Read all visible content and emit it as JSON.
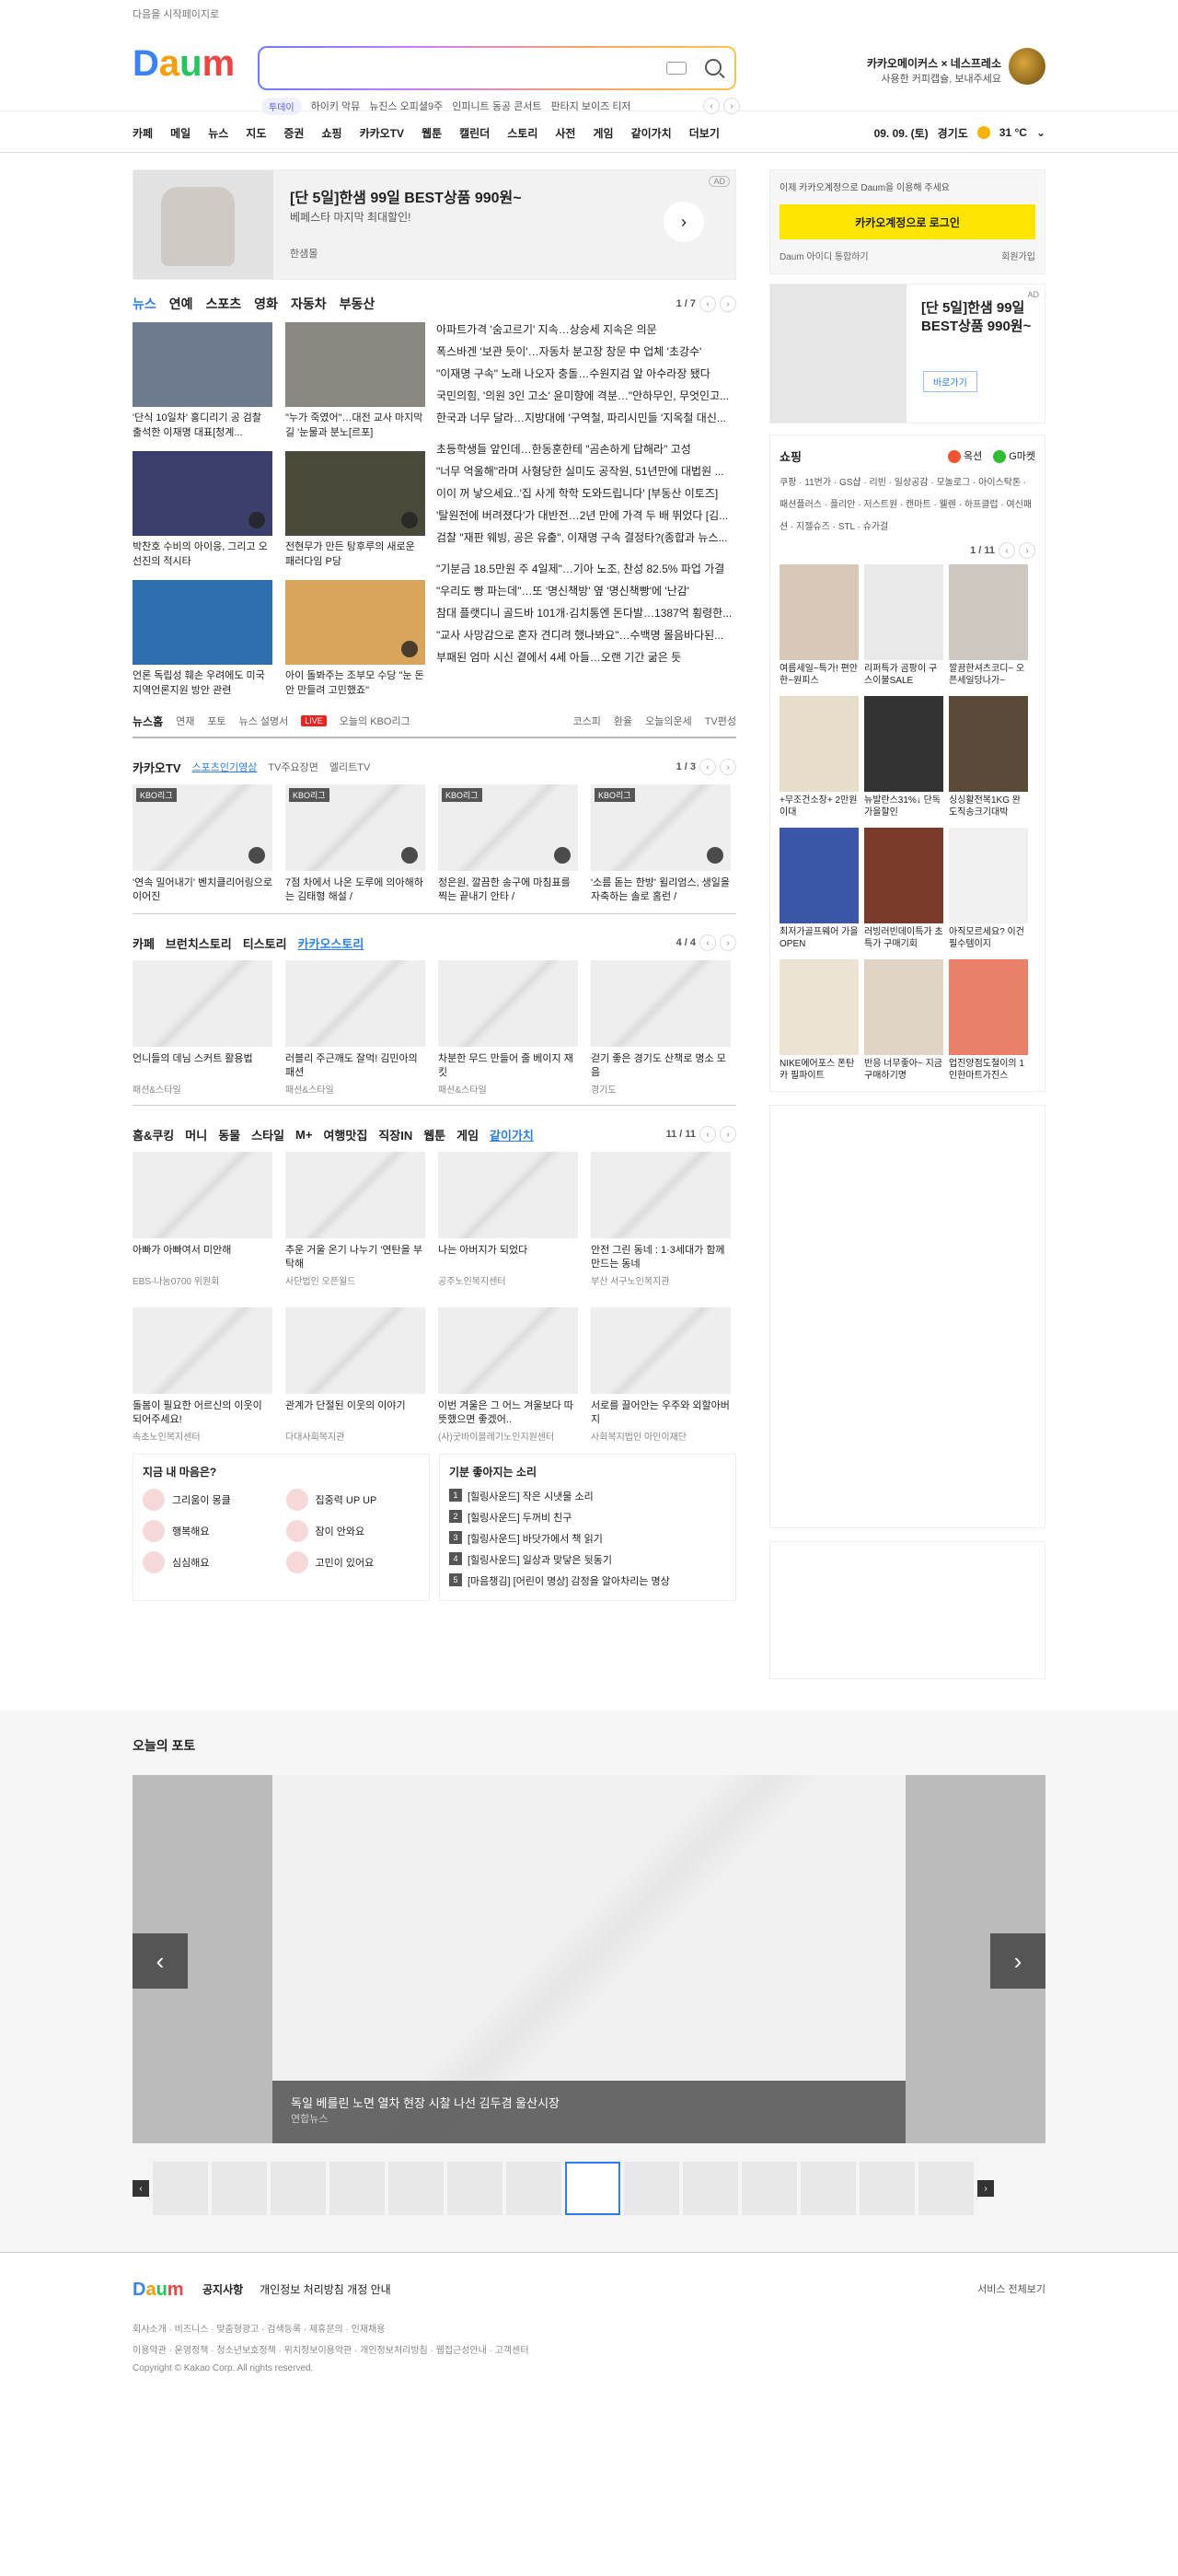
{
  "top_link": "다음을 시작페이지로",
  "search": {
    "placeholder": ""
  },
  "trend": {
    "tag": "투데이",
    "items": [
      "하이키 악뮤",
      "뉴진스 오피셜9주",
      "인피니트 동공 콘서트",
      "판타지 보이즈 티저"
    ]
  },
  "promo": {
    "title": "카카오메이커스 × 네스프레소",
    "sub": "사용한 커피캡슐, 보내주세요"
  },
  "gnb": [
    "카페",
    "메일",
    "뉴스",
    "지도",
    "증권",
    "쇼핑",
    "카카오TV",
    "웹툰",
    "캘린더",
    "스토리",
    "사전",
    "게임",
    "같이가치",
    "더보기"
  ],
  "weather": {
    "date": "09. 09. (토)",
    "region": "경기도",
    "temp": "31 °C"
  },
  "ad_main": {
    "title": "[단 5일]한샘 99일 BEST상품 990원~",
    "sub": "베페스타 마지막 최대할인!",
    "brand": "한샘몰",
    "tag": "AD"
  },
  "news_tabs": [
    "뉴스",
    "연예",
    "스포츠",
    "영화",
    "자동차",
    "부동산"
  ],
  "news_pager": "1 / 7",
  "news_thumbs": [
    {
      "cap": "'단식 10일차' 홍디리기 공 검찰 출석한 이재명 대표[청계..."
    },
    {
      "cap": "\"누가 죽였어\"…대전 교사 마지막길 '눈물과 분노[르포]"
    },
    {
      "cap": "박찬호 수비의 아이응, 그리고 오선진의 적시타"
    },
    {
      "cap": "전현무가 만든 탕후루의 새로운 패러다임 P당"
    },
    {
      "cap": "언론 독립성 훼손 우려에도 미국 지역언론지원 방안 관련"
    },
    {
      "cap": "아이 돌봐주는 조부모 수당 \"눈 돈 안 만들려 고민했죠\""
    }
  ],
  "headlines": [
    [
      "아파트가격 '숨고르기' 지속…상승세 지속은 의문",
      "폭스바겐 '보관 듯이'…자동차 분고장 창문 中 업체 '초강수'",
      "\"이재명 구속\" 노래 나오자 충돌…수원지검 앞 아수라장 됐다",
      "국민의힘, '의원 3인 고소' 윤미향에 격분…\"안하무인, 무엇인고...",
      "한국과 너무 달라…지방대에 '구역철, 파리시민들 '지옥철 대신..."
    ],
    [
      "초등학생들 앞인데…한동훈한테 \"곰손하게 답해라\" 고성",
      "\"너무 억울해\"라며 사형당한 실미도 공작원, 51년만에 대법원 ...",
      "이이 꺼 낳으세요..'집 사게 학학 도와드립니다' [부동산 이토즈]",
      "'탈원전에 버려졌다'가 대반전…2년 만에 가격 두 배 뛰었다 [김...",
      "검찰 \"재판 웨빙, 공은 유출\", 이재명 구속 결정타?(종합과 뉴스..."
    ],
    [
      "\"기분금 18.5만원 주 4일제\"…기아 노조, 찬성 82.5% 파업 가결",
      "\"우리도 빵 파는데\"…또 '명신책방' 옆 '명신책빵'에 '난감'",
      "참대 플랫디니 골드바 101개·김치통엔 돈다발…1387억 횡령한...",
      "\"교사 사망감으로 혼자 견디려 했나봐요\"…수백명 몰음바다된...",
      "부패된 엄마 시신 곁에서 4세 아들…오랜 기간 굶은 듯"
    ]
  ],
  "newsbar": {
    "title": "뉴스홈",
    "links": [
      "연재",
      "포토",
      "뉴스 설명서"
    ],
    "live": "LIVE",
    "live_text": "오늘의 KBO리그",
    "right": [
      "코스피",
      "환율",
      "오늘의운세",
      "TV편성"
    ]
  },
  "kakaotv": {
    "title": "카카오TV",
    "tab_on": "스포츠인기영상",
    "tabs": [
      "TV주요장면",
      "엘리트TV"
    ],
    "pager": "1 / 3",
    "badge": "KBO리그",
    "items": [
      "'연속 밀어내기' 벤치클리어링으로 이어진",
      "7점 차에서 나온 도루에 의아해하는 김태형 해설 /",
      "정은원, 깔끔한 송구에 마침표를 찍는 끝내기 안타 /",
      "'소름 돋는 한방' 윌리엄스, 생일을 자축하는 솔로 홈런 /"
    ]
  },
  "cafe": {
    "tabs": [
      "카페",
      "브런치스토리",
      "티스토리"
    ],
    "tab_on": "카카오스토리",
    "pager": "4 / 4",
    "items": [
      {
        "t": "언니들의 데님 스커트 활용법",
        "s": "패션&스타일"
      },
      {
        "t": "러블리 주근깨도 잘먹! 김민아의 패션",
        "s": "패션&스타일"
      },
      {
        "t": "차분한 무드 만들어 줄 베이지 재킷",
        "s": "패션&스타일"
      },
      {
        "t": "걷기 좋은 경기도 산책로 명소 모음",
        "s": "경기도"
      }
    ]
  },
  "home": {
    "tabs": [
      "홈&쿠킹",
      "머니",
      "동물",
      "스타일",
      "M+",
      "여행맛집",
      "직장IN",
      "웹툰",
      "게임"
    ],
    "tab_on": "같이가치",
    "pager": "11 / 11",
    "items": [
      {
        "t": "아빠가 아빠여서 미안해",
        "s": "EBS-나눔0700 위원회"
      },
      {
        "t": "추운 거울 온기 나누기 '연탄을 부탁해",
        "s": "사단법인 오픈월드"
      },
      {
        "t": "나는 아버지가 되었다",
        "s": "공주노인복지센터"
      },
      {
        "t": "안전 그린 동네 : 1·3세대가 함께 만드는 동네",
        "s": "부산 서구노인복지관"
      },
      {
        "t": "돌봄이 필요한 어르신의 이웃이 되어주세요!",
        "s": "속초노인복지센터"
      },
      {
        "t": "관계가 단절된 이웃의 이야기",
        "s": "다대사회복지관"
      },
      {
        "t": "이번 겨울은 그 어느 겨울보다 따뜻했으면 좋겠어..",
        "s": "(사)굿바이블레기노인지원센터"
      },
      {
        "t": "서로를 끌어안는 우주와 외할아버지",
        "s": "사회복지법인 아인이재단"
      }
    ]
  },
  "mood": {
    "title": "지금 내 마음은?",
    "items": [
      "그리움이 몽클",
      "집중력 UP UP",
      "행복해요",
      "잠이 안와요",
      "심심해요",
      "고민이 있어요"
    ]
  },
  "sound": {
    "title": "기분 좋아지는 소리",
    "items": [
      "[힐링사운드] 작은 시냇물 소리",
      "[힐링사운드] 두꺼비 친구",
      "[힐링사운드] 바닷가에서 책 읽기",
      "[힐링사운드] 일상과 맞닿은 뒷동기",
      "[마음챙김] [어린이 명상] 감정을 알아차리는 명상"
    ]
  },
  "login": {
    "notice": "이제 카카오계정으로 Daum을 이용해 주세요",
    "btn": "카카오계정으로 로그인",
    "left": "Daum 아이디 통합하기",
    "right": "회원가입"
  },
  "ad_right": {
    "title": "[단 5일]한샘 99일 BEST상품 990원~",
    "btn": "바로가기",
    "tag": "AD"
  },
  "shop": {
    "title": "쇼핑",
    "malls": [
      "옥션",
      "G마켓"
    ],
    "links": "쿠팡 · 11번가 · GS샵 · 리빈 · 일상공감 · 모놀로그 · 아이스탁톤 · 패션플러스 · 플리안 · 저스트원 · 캔마트 · 웰렌 · 하프클럽 · 여신패션 · 지젤슈즈 · STL · 슈가걸",
    "pager": "1 / 11",
    "items": [
      "여름세일~특가! 편안한~원피스",
      "리퍼특가 곰팡이 구스이불SALE",
      "깔끔한셔츠코디~ 오픈세일당나가~",
      "+무조건소장+ 2만원이대",
      "뉴발란스31%↓ 단독가을할인",
      "싱싱활전복1KG 완도직송크기대박",
      "최저가골프웨어 가을 OPEN",
      "러빙러빈데이특가 초특가 구매기회",
      "아직모르세요? 이건 필수템이지",
      "NIKE에어포스 폰탄카 필파이트",
      "반응 너무좋아~ 지금 구매하기명",
      "업진양점도철이의 1인한마트가진스"
    ]
  },
  "photo": {
    "title": "오늘의 포토",
    "caption": "독일 베를린 노면 열차 현장 시찰 나선 김두겸 울산시장",
    "source": "연합뉴스"
  },
  "footer": {
    "notice_label": "공지사항",
    "notice": "개인정보 처리방침 개정 안내",
    "more": "서비스 전체보기",
    "row1": "회사소개 · 비즈니스 · 맞춤형광고 · 검색등록 · 제휴문의 · 인재채용",
    "row2": "이용약관 · 운영정책 · 청소년보호정책 · 위치정보이용약관 · 개인정보처리방침 · 웹접근성안내 · 고객센터",
    "copy": "Copyright © Kakao Corp. All rights reserved."
  }
}
